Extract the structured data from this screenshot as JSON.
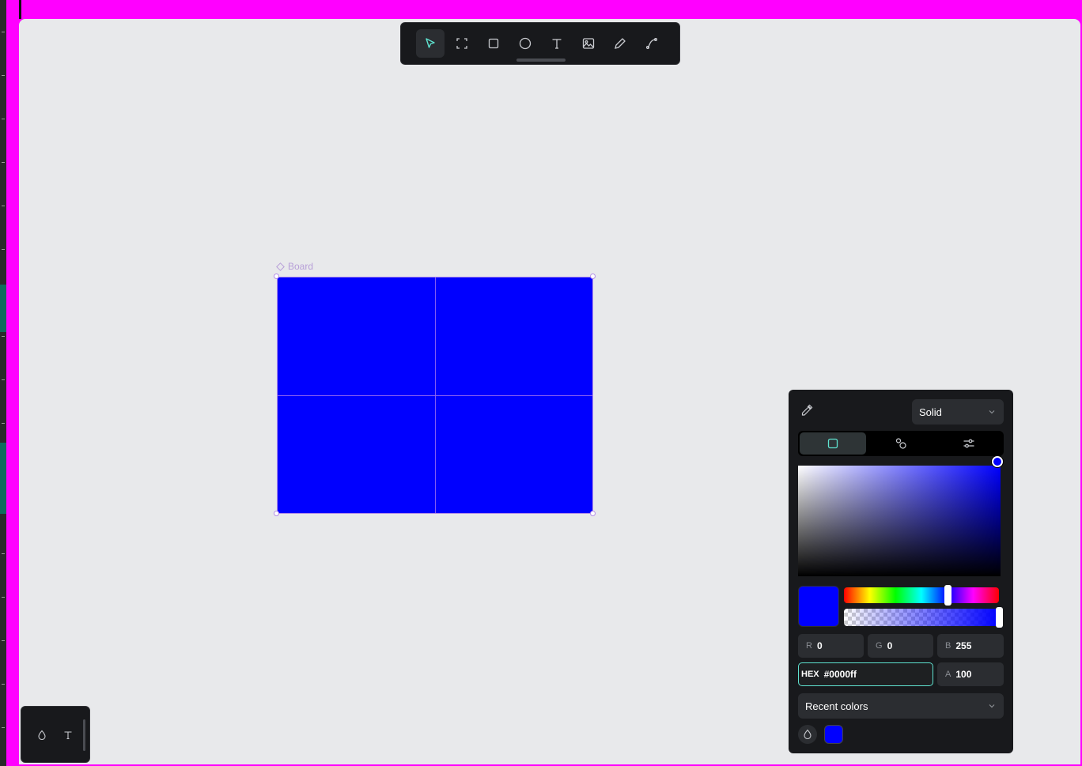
{
  "board": {
    "label": "Board",
    "fill": "#0000ff"
  },
  "toolbar": {
    "tools": [
      {
        "name": "select",
        "icon": "pointer-icon",
        "active": true
      },
      {
        "name": "frame",
        "icon": "board-icon",
        "active": false
      },
      {
        "name": "rectangle",
        "icon": "rectangle-icon",
        "active": false
      },
      {
        "name": "ellipse",
        "icon": "ellipse-icon",
        "active": false
      },
      {
        "name": "text",
        "icon": "text-icon",
        "active": false
      },
      {
        "name": "image",
        "icon": "image-icon",
        "active": false
      },
      {
        "name": "pencil",
        "icon": "pencil-icon",
        "active": false
      },
      {
        "name": "path",
        "icon": "path-icon",
        "active": false
      }
    ]
  },
  "color_picker": {
    "mode": "Solid",
    "fields": {
      "r_label": "R",
      "r_value": "0",
      "g_label": "G",
      "g_value": "0",
      "b_label": "B",
      "b_value": "255",
      "hex_label": "HEX",
      "hex_value": "#0000ff",
      "a_label": "A",
      "a_value": "100"
    },
    "recent_label": "Recent colors",
    "current_color": "#0000ff",
    "accent": "#5fe3d0"
  },
  "mini_toolbar": {
    "items": [
      "fill-drop-icon",
      "text-icon"
    ]
  }
}
